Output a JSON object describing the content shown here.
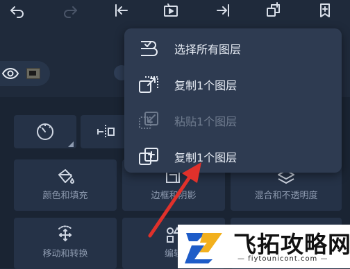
{
  "toolbar": {
    "icons": [
      "undo-icon",
      "redo-icon",
      "skip-to-start-icon",
      "play-icon",
      "skip-to-end-icon",
      "duplicate-icon",
      "bookmark-add-icon"
    ]
  },
  "panel": {
    "cards": [
      {
        "label": "颜色和填充",
        "icon": "paint-bucket-icon"
      },
      {
        "label": "边框和阴影",
        "icon": "border-shadow-icon"
      },
      {
        "label": "混合和不透明度",
        "icon": "blend-icon"
      },
      {
        "label": "移动和转换",
        "icon": "move-transform-icon"
      },
      {
        "label": "编辑",
        "icon": "edit-shapes-icon"
      }
    ],
    "row1_icons": [
      "speedometer-icon",
      "flip-icon"
    ]
  },
  "menu": {
    "items": [
      {
        "label": "选择所有图层",
        "icon": "select-all-layers-icon",
        "enabled": true
      },
      {
        "label": "复制1个图层",
        "icon": "copy-layer-icon",
        "enabled": true
      },
      {
        "label": "粘贴1个图层",
        "icon": "paste-layer-icon",
        "enabled": false
      },
      {
        "label": "复制1个图层",
        "icon": "duplicate-layer-icon",
        "enabled": true
      }
    ]
  },
  "watermark": {
    "title": "飞拓攻略网",
    "url": "— fiytounicont.com —"
  },
  "colors": {
    "background": "#1f2a3b",
    "menu": "#2e3b51",
    "arrow": "#e0312b"
  }
}
